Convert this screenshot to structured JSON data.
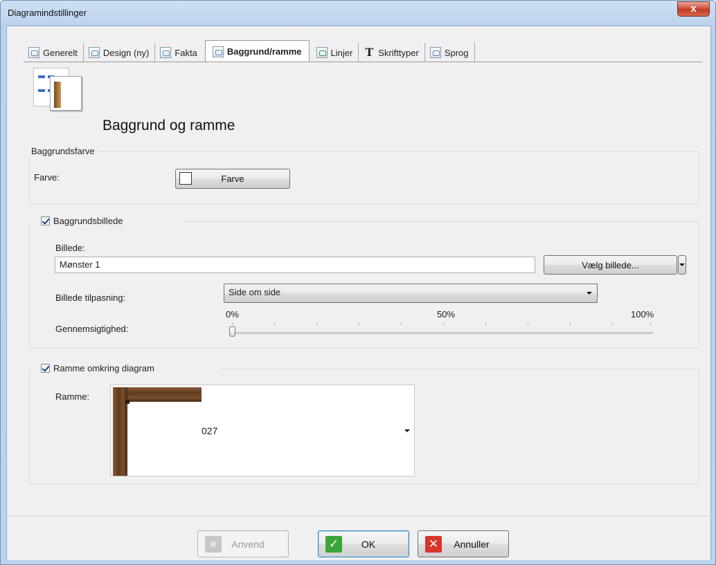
{
  "window": {
    "title": "Diagramindstillinger",
    "close_glyph": "x"
  },
  "tabs": [
    {
      "label": "Generelt",
      "icon": "settings-icon"
    },
    {
      "label": "Design (ny)",
      "icon": "design-icon"
    },
    {
      "label": "Fakta",
      "icon": "facts-icon"
    },
    {
      "label": "Baggrund/ramme",
      "icon": "background-icon",
      "active": true
    },
    {
      "label": "Linjer",
      "icon": "lines-icon"
    },
    {
      "label": "Skrifttyper",
      "icon": "font-icon",
      "glyph": "T"
    },
    {
      "label": "Sprog",
      "icon": "language-icon"
    }
  ],
  "page": {
    "title": "Baggrund og ramme"
  },
  "background_color": {
    "legend": "Baggrundsfarve",
    "color_label": "Farve:",
    "button_label": "Farve",
    "swatch_color": "#ffffff"
  },
  "background_image": {
    "legend": "Baggrundsbillede",
    "checked": true,
    "image_label": "Billede:",
    "image_value": "Mønster 1",
    "choose_button": "Vælg billede...",
    "fit_label": "Billede tilpasning:",
    "fit_value": "Side om side",
    "opacity_label": "Gennemsigtighed:",
    "scale_min": "0%",
    "scale_mid": "50%",
    "scale_max": "100%",
    "opacity_value": 0
  },
  "frame": {
    "legend": "Ramme omkring diagram",
    "checked": true,
    "frame_label": "Ramme:",
    "frame_value": "027",
    "frame_color": "#6b4424"
  },
  "footer": {
    "apply": "Anvend",
    "ok": "OK",
    "cancel": "Annuller",
    "ok_color": "#3aa53a",
    "cancel_color": "#d8352a"
  }
}
